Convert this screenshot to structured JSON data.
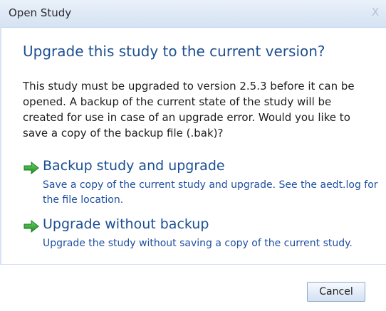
{
  "window": {
    "title": "Open Study",
    "close_label": "X"
  },
  "dialog": {
    "heading": "Upgrade this study to the current version?",
    "message": "This study must be upgraded to version 2.5.3 before it can be opened. A backup of the current state of the study will be created for use in case of an upgrade error. Would you like to save a copy of the backup file (.bak)?"
  },
  "options": [
    {
      "title": "Backup study and upgrade",
      "description": "Save a copy of the current study and upgrade. See the aedt.log for the file location.",
      "icon": "green-arrow-icon"
    },
    {
      "title": "Upgrade without backup",
      "description": "Upgrade the study without saving a copy of the current study.",
      "icon": "green-arrow-icon"
    }
  ],
  "footer": {
    "cancel_label": "Cancel"
  },
  "colors": {
    "heading": "#1e4f91",
    "link": "#1b4e93",
    "arrow": "#2e9e2e"
  }
}
